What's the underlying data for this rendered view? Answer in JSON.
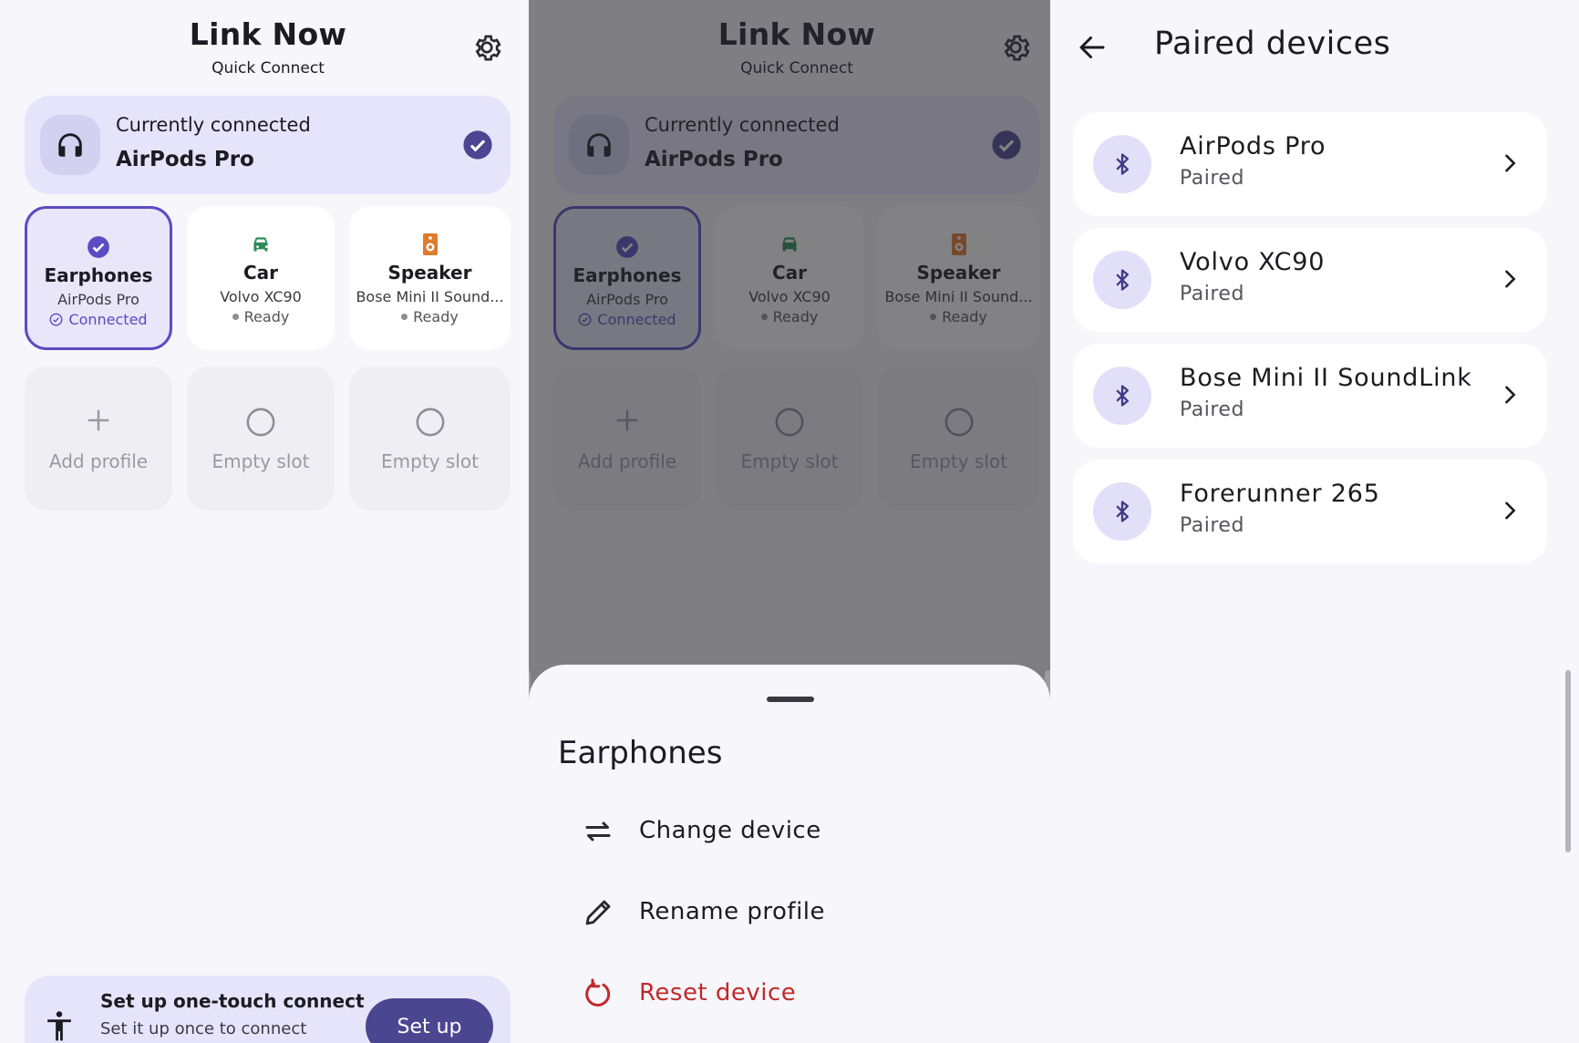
{
  "home": {
    "title": "Link Now",
    "subtitle": "Quick Connect",
    "current": {
      "label": "Currently connected",
      "device": "AirPods Pro"
    },
    "profiles": [
      {
        "name": "Earphones",
        "device": "AirPods Pro",
        "status": "Connected",
        "icon": "check-circle-icon",
        "color": "#5b4bc4"
      },
      {
        "name": "Car",
        "device": "Volvo XC90",
        "status": "Ready",
        "icon": "car-icon",
        "color": "#2e8b57"
      },
      {
        "name": "Speaker",
        "device": "Bose Mini II Sound...",
        "status": "Ready",
        "icon": "speaker-icon",
        "color": "#e07b2c"
      }
    ],
    "slots": [
      {
        "label": "Add profile",
        "icon": "plus-icon"
      },
      {
        "label": "Empty slot",
        "icon": "empty-circle-icon"
      },
      {
        "label": "Empty slot",
        "icon": "empty-circle-icon"
      }
    ],
    "setup": {
      "title": "Set up one-touch connect",
      "subtitle": "Set it up once to connect",
      "button": "Set up"
    }
  },
  "sheet": {
    "title": "Earphones",
    "items": [
      {
        "label": "Change device",
        "icon": "swap-arrows-icon"
      },
      {
        "label": "Rename profile",
        "icon": "pencil-icon"
      },
      {
        "label": "Reset device",
        "icon": "reset-icon",
        "color": "#c02a2a"
      }
    ]
  },
  "paired": {
    "title": "Paired devices",
    "devices": [
      {
        "name": "AirPods Pro",
        "status": "Paired"
      },
      {
        "name": "Volvo XC90",
        "status": "Paired"
      },
      {
        "name": "Bose Mini II SoundLink",
        "status": "Paired"
      },
      {
        "name": "Forerunner 265",
        "status": "Paired"
      }
    ]
  },
  "colors": {
    "accent": "#5b4bc4",
    "card": "#e6e4fa",
    "button": "#4a4690",
    "danger": "#c02a2a"
  }
}
